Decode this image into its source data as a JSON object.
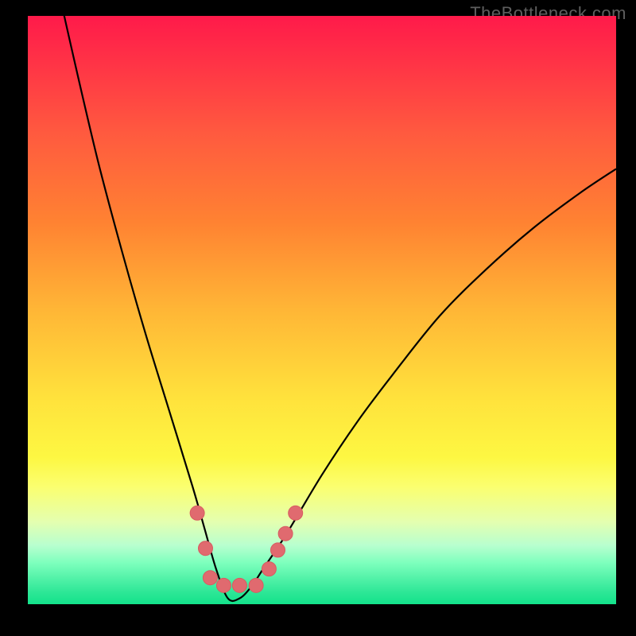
{
  "watermark": "TheBottleneck.com",
  "colors": {
    "background": "#000000",
    "curve": "#000000",
    "marker_fill": "#e06a6f",
    "marker_stroke": "#d85a60",
    "gradient_top": "#ff1a4a",
    "gradient_bottom": "#13e28b"
  },
  "chart_data": {
    "type": "line",
    "title": "",
    "xlabel": "",
    "ylabel": "",
    "xlim": [
      0,
      100
    ],
    "ylim": [
      0,
      100
    ],
    "grid": false,
    "legend": false,
    "series": [
      {
        "name": "bottleneck-curve",
        "comment": "Approximate V-shaped curve; y is % (0 at bottom/green, 100 at top/red). Minimum near x≈34.",
        "x": [
          0,
          4,
          8,
          12,
          16,
          20,
          24,
          28,
          30,
          32,
          34,
          36,
          38,
          40,
          44,
          50,
          56,
          62,
          70,
          78,
          86,
          94,
          100
        ],
        "y": [
          130,
          110,
          92,
          75,
          60,
          46,
          33,
          20,
          13,
          6,
          1,
          1,
          3,
          6,
          12,
          22,
          31,
          39,
          49,
          57,
          64,
          70,
          74
        ]
      }
    ],
    "markers": {
      "comment": "Salmon dots near the trough of the curve (plot-fraction coords, 0..1, y from top).",
      "points": [
        {
          "x": 0.288,
          "y": 0.845
        },
        {
          "x": 0.302,
          "y": 0.905
        },
        {
          "x": 0.31,
          "y": 0.955
        },
        {
          "x": 0.333,
          "y": 0.968
        },
        {
          "x": 0.36,
          "y": 0.968
        },
        {
          "x": 0.388,
          "y": 0.968
        },
        {
          "x": 0.41,
          "y": 0.94
        },
        {
          "x": 0.425,
          "y": 0.908
        },
        {
          "x": 0.438,
          "y": 0.88
        },
        {
          "x": 0.455,
          "y": 0.845
        }
      ],
      "radius_px": 9
    }
  }
}
